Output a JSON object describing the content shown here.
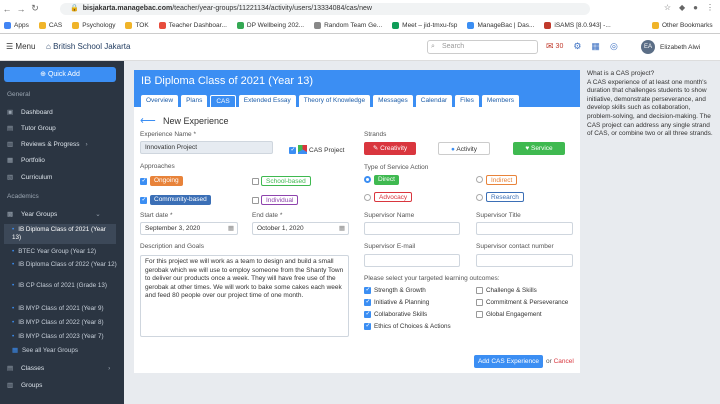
{
  "browser": {
    "url_prefix": "bisjakarta.managebac.com",
    "url_path": "/teacher/year-groups/11221134/activity/users/13334084/cas/new",
    "bookmarks": [
      "Apps",
      "CAS",
      "Psychology",
      "TOK",
      "Teacher Dashboar...",
      "DP Wellbeing 202...",
      "Random Team Ge...",
      "Meet – jid-tmxu-fsp",
      "ManageBac | Das...",
      "iSAMS [8.0.943] -..."
    ],
    "other_bookmarks": "Other Bookmarks"
  },
  "topbar": {
    "menu_label": "Menu",
    "school_name": "British School Jakarta",
    "search_placeholder": "Search",
    "mail_count": "30",
    "avatar_initials": "EA",
    "user_name": "Elizabeth Alwi"
  },
  "sidebar": {
    "quick_add": "Quick Add",
    "general_label": "General",
    "general_items": [
      "Dashboard",
      "Tutor Group",
      "Reviews & Progress",
      "Portfolio",
      "Curriculum"
    ],
    "academics_label": "Academics",
    "year_groups_label": "Year Groups",
    "year_groups": [
      "IB Diploma Class of 2021 (Year 13)",
      "BTEC Year Group (Year 12)",
      "IB Diploma Class of 2022 (Year 12)",
      "IB CP Class of 2021 (Grade 13)",
      "IB MYP Class of 2021 (Year 9)",
      "IB MYP Class of 2022 (Year 8)",
      "IB MYP Class of 2023 (Year 7)"
    ],
    "see_all": "See all Year Groups",
    "classes": "Classes",
    "groups": "Groups"
  },
  "page": {
    "title": "IB Diploma Class of 2021 (Year 13)",
    "tabs": [
      "Overview",
      "Plans",
      "CAS",
      "Extended Essay",
      "Theory of Knowledge",
      "Messages",
      "Calendar",
      "Files",
      "Members"
    ],
    "form_title": "New Experience"
  },
  "form": {
    "experience_name_label": "Experience Name *",
    "experience_name_value": "Innovation Project",
    "cas_project_label": "CAS Project",
    "approaches_label": "Approaches",
    "approaches": [
      "Ongoing",
      "School-based",
      "Community-based",
      "Individual"
    ],
    "start_date_label": "Start date *",
    "start_date_value": "September 3, 2020",
    "end_date_label": "End date *",
    "end_date_value": "October 1, 2020",
    "description_label": "Description and Goals",
    "description_text": "For this project we will work as a team to design and build a small gerobak which we will use to employ someone from the Shanty Town to deliver our products once a week. They will have free use of the gerobak at other times. We will work to bake some cakes each week and feed 80 people over our project time of one month.",
    "strands_label": "Strands",
    "strands": [
      "Creativity",
      "Activity",
      "Service"
    ],
    "service_type_label": "Type of Service Action",
    "service_types": [
      "Direct",
      "Indirect",
      "Advocacy",
      "Research"
    ],
    "supervisor_name_label": "Supervisor Name",
    "supervisor_title_label": "Supervisor Title",
    "supervisor_email_label": "Supervisor E-mail",
    "supervisor_contact_label": "Supervisor contact number",
    "outcomes_label": "Please select your targeted learning outcomes:",
    "outcomes_left": [
      "Strength & Growth",
      "Initiative & Planning",
      "Collaborative Skills",
      "Ethics of Choices & Actions"
    ],
    "outcomes_right": [
      "Challenge & Skills",
      "Commitment & Perseverance",
      "Global Engagement"
    ],
    "add_button": "Add CAS Experience",
    "or_text": "or",
    "cancel": "Cancel"
  },
  "help": {
    "heading": "What is a CAS project?",
    "body": "A CAS experience of at least one month's duration that challenges students to show initiative, demonstrate perseverance, and develop skills such as collaboration, problem-solving, and decision-making. The CAS project can address any single strand of CAS, or combine two or all three strands."
  },
  "colors": {
    "accent": "#3b8ef3",
    "creativity": "#d9363e",
    "service": "#3fb950",
    "ongoing": "#e8833a",
    "sidebar": "#2b3542"
  }
}
